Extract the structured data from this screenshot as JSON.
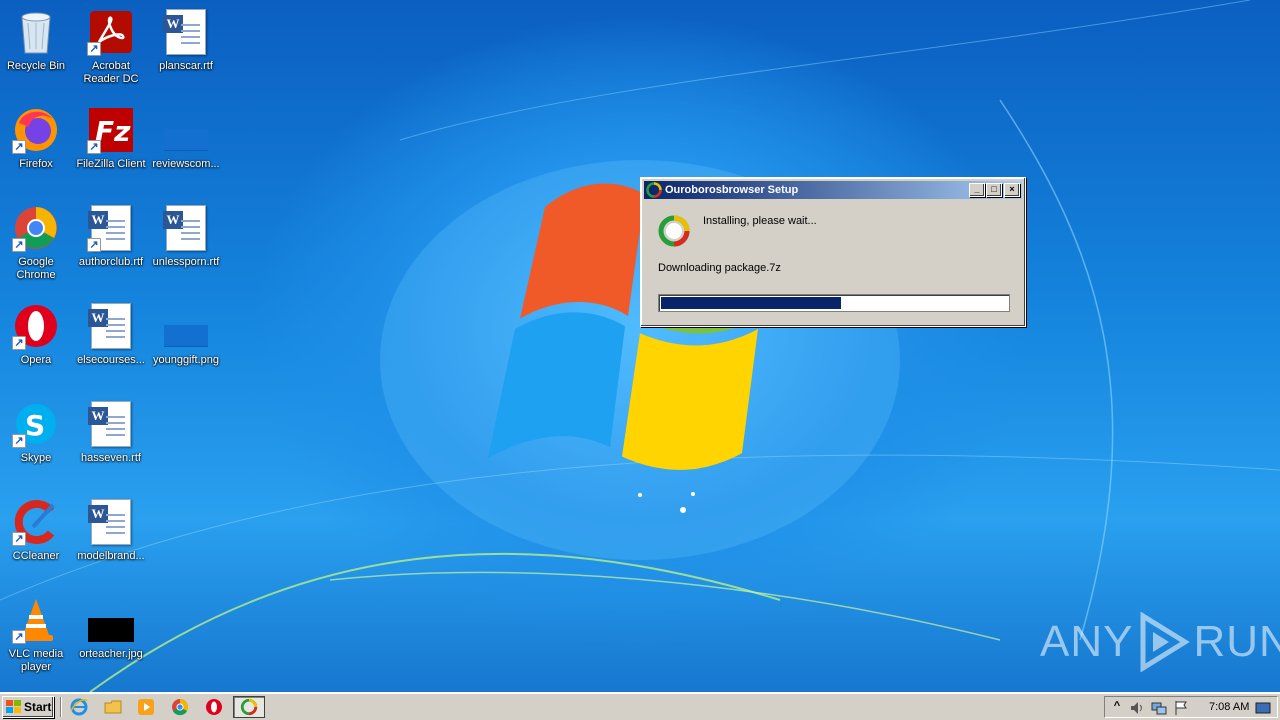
{
  "desktop": {
    "icons": [
      {
        "label": "Recycle Bin",
        "icon": "recycle-bin-icon"
      },
      {
        "label": "Acrobat Reader DC",
        "icon": "acrobat-icon"
      },
      {
        "label": "planscar.rtf",
        "icon": "word-doc-icon"
      },
      {
        "label": "Firefox",
        "icon": "firefox-icon"
      },
      {
        "label": "FileZilla Client",
        "icon": "filezilla-icon"
      },
      {
        "label": "reviewscom...",
        "icon": "blank-file-icon"
      },
      {
        "label": "Google Chrome",
        "icon": "chrome-icon"
      },
      {
        "label": "authorclub.rtf",
        "icon": "word-doc-icon"
      },
      {
        "label": "unlessporn.rtf",
        "icon": "word-doc-icon"
      },
      {
        "label": "Opera",
        "icon": "opera-icon"
      },
      {
        "label": "elsecourses...",
        "icon": "word-doc-icon"
      },
      {
        "label": "younggift.png",
        "icon": "image-file-icon"
      },
      {
        "label": "Skype",
        "icon": "skype-icon"
      },
      {
        "label": "hasseven.rtf",
        "icon": "word-doc-icon"
      },
      {
        "label": "CCleaner",
        "icon": "ccleaner-icon"
      },
      {
        "label": "modelbrand...",
        "icon": "word-doc-icon"
      },
      {
        "label": "VLC media player",
        "icon": "vlc-icon"
      },
      {
        "label": "orteacher.jpg",
        "icon": "image-file-icon"
      }
    ]
  },
  "dialog": {
    "title": "Ouroborosbrowser Setup",
    "status": "Installing, please wait...",
    "detail": "Downloading package.7z",
    "progress_fraction": 0.52,
    "buttons": {
      "minimize": "_",
      "maximize": "□",
      "close": "×"
    }
  },
  "watermark": {
    "text_left": "ANY",
    "text_right": "RUN"
  },
  "taskbar": {
    "start_label": "Start",
    "quick_launch": [
      "internet-explorer-icon",
      "explorer-folder-icon",
      "media-player-icon",
      "chrome-icon",
      "opera-icon"
    ],
    "active_task_icon": "ouroboros-setup-icon",
    "tray_icons": [
      "show-hidden-icons-icon",
      "volume-icon",
      "network-icon",
      "action-center-flag-icon",
      "show-desktop-icon"
    ],
    "clock": "7:08 AM",
    "tray_arrow": "^"
  },
  "colors": {
    "titlebar_start": "#0a246a",
    "titlebar_end": "#a6caf0",
    "progress_fill": "#0a246a",
    "dialog_bg": "#d4d0c8"
  }
}
